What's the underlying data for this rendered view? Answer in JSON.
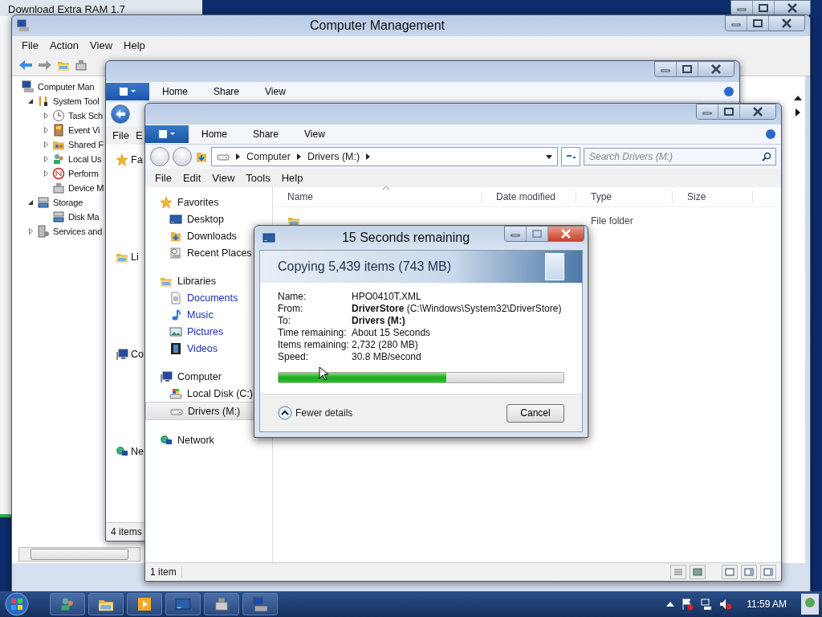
{
  "background_window": {
    "title": "Download Extra RAM 1.7"
  },
  "computer_management": {
    "title": "Computer Management",
    "menu": [
      "File",
      "Action",
      "View",
      "Help"
    ],
    "tree": [
      {
        "label": "Computer Man",
        "children": [
          {
            "label": "System Tool",
            "expanded": true,
            "children": [
              {
                "label": "Task Sch",
                "expanded": false
              },
              {
                "label": "Event Vi",
                "expanded": false
              },
              {
                "label": "Shared F",
                "expanded": false
              },
              {
                "label": "Local Us",
                "expanded": false
              },
              {
                "label": "Perform",
                "expanded": false
              },
              {
                "label": "Device M"
              }
            ]
          },
          {
            "label": "Storage",
            "expanded": true,
            "children": [
              {
                "label": "Disk Ma"
              }
            ]
          },
          {
            "label": "Services and",
            "expanded": false
          }
        ]
      }
    ]
  },
  "explorer_back": {
    "tabs": [
      "Home",
      "Share",
      "View"
    ],
    "menu": [
      "File",
      "E"
    ],
    "nav": [
      "Fa",
      "Li",
      "Co",
      "Ne"
    ],
    "status": "4 items"
  },
  "explorer": {
    "tabs": [
      "Home",
      "Share",
      "View"
    ],
    "address": [
      "Computer",
      "Drivers (M:)"
    ],
    "search": {
      "placeholder": "Search Drivers (M:)"
    },
    "menu": [
      "File",
      "Edit",
      "View",
      "Tools",
      "Help"
    ],
    "nav": [
      {
        "label": "Favorites",
        "children": [
          {
            "label": "Desktop",
            "link": false,
            "selected": false
          },
          {
            "label": "Downloads",
            "link": false,
            "selected": false
          },
          {
            "label": "Recent Places",
            "link": false,
            "selected": false
          }
        ]
      },
      {
        "label": "Libraries",
        "children": [
          {
            "label": "Documents",
            "link": true,
            "selected": false
          },
          {
            "label": "Music",
            "link": true,
            "selected": false
          },
          {
            "label": "Pictures",
            "link": true,
            "selected": false
          },
          {
            "label": "Videos",
            "link": true,
            "selected": false
          }
        ]
      },
      {
        "label": "Computer",
        "children": [
          {
            "label": "Local Disk (C:)",
            "link": false,
            "selected": false
          },
          {
            "label": "Drivers (M:)",
            "link": false,
            "selected": true
          }
        ]
      },
      {
        "label": "Network"
      }
    ],
    "columns": [
      "Name",
      "Date modified",
      "Type",
      "Size"
    ],
    "rows": [
      {
        "type": "File folder"
      }
    ],
    "status": "1 item"
  },
  "copy_dialog": {
    "title": "15 Seconds remaining",
    "heading": "Copying 5,439 items (743 MB)",
    "details": [
      {
        "label": "Name:",
        "value": "HPO0410T.XML",
        "bold": false
      },
      {
        "label": "From:",
        "value": "**DriverStore** (C:\\Windows\\System32\\DriverStore)",
        "bold": false
      },
      {
        "label": "To:",
        "value": "Drivers (M:)",
        "bold": true
      },
      {
        "label": "Time remaining:",
        "value": "About 15 Seconds",
        "bold": false
      },
      {
        "label": "Items remaining:",
        "value": "2,732 (280 MB)",
        "bold": false
      },
      {
        "label": "Speed:",
        "value": "30.8 MB/second",
        "bold": false
      }
    ],
    "progress": {
      "level": 0.59
    },
    "toggle": "Fewer details",
    "cancel": "Cancel"
  },
  "taskbar": {
    "clock": "11:59 AM"
  }
}
